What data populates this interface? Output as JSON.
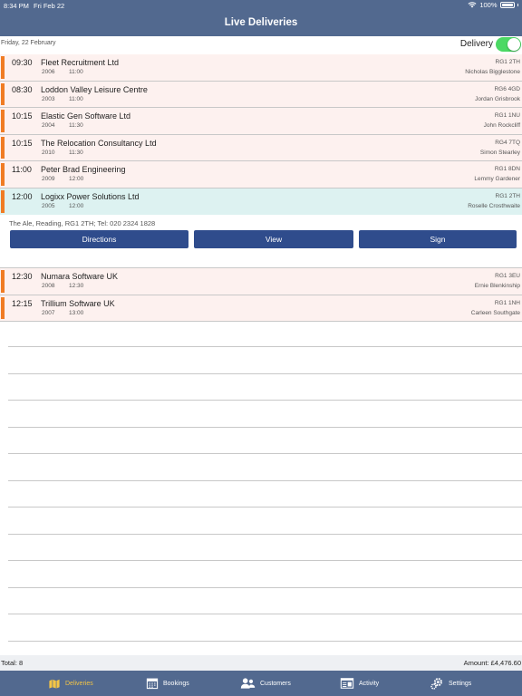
{
  "status": {
    "time": "8:34 PM",
    "date": "Fri Feb 22",
    "battery": "100%"
  },
  "header": {
    "title": "Live Deliveries"
  },
  "datebar": {
    "date": "Friday, 22 February",
    "toggle_label": "Delivery",
    "toggle_on": true
  },
  "deliveries": [
    {
      "time": "09:30",
      "company": "Fleet Recruitment Ltd",
      "code": "2006",
      "slot": "11:00",
      "postcode": "RG1 2TH",
      "contact": "Nicholas Bigglestone"
    },
    {
      "time": "08:30",
      "company": "Loddon Valley Leisure Centre",
      "code": "2003",
      "slot": "11:00",
      "postcode": "RG6 4GD",
      "contact": "Jordan Grisbrook"
    },
    {
      "time": "10:15",
      "company": "Elastic Gen Software Ltd",
      "code": "2004",
      "slot": "11:30",
      "postcode": "RG1 1NU",
      "contact": "John Rockcliff"
    },
    {
      "time": "10:15",
      "company": "The Relocation Consultancy Ltd",
      "code": "2010",
      "slot": "11:30",
      "postcode": "RG4 7TQ",
      "contact": "Simon Stearley"
    },
    {
      "time": "11:00",
      "company": "Peter Brad Engineering",
      "code": "2009",
      "slot": "12:00",
      "postcode": "RG1 8DN",
      "contact": "Lemmy Gardener"
    },
    {
      "time": "12:00",
      "company": "Logixx Power Solutions Ltd",
      "code": "2005",
      "slot": "12:00",
      "postcode": "RG1 2TH",
      "contact": "Roselle Crosthwaite"
    },
    {
      "time": "12:30",
      "company": "Numara Software UK",
      "code": "2008",
      "slot": "12:30",
      "postcode": "RG1 3EU",
      "contact": "Ernie Blenkinship"
    },
    {
      "time": "12:15",
      "company": "Trillium Software UK",
      "code": "2007",
      "slot": "13:00",
      "postcode": "RG1 1NH",
      "contact": "Carleen Southgate"
    }
  ],
  "selected_detail": {
    "address": "The Ale, Reading, RG1 2TH; Tel:  020 2324 1828",
    "buttons": {
      "directions": "Directions",
      "view": "View",
      "sign": "Sign"
    }
  },
  "footer": {
    "total": "Total: 8",
    "amount": "Amount: £4,476.60"
  },
  "tabs": [
    {
      "label": "Deliveries",
      "icon": "map-icon",
      "active": true
    },
    {
      "label": "Bookings",
      "icon": "calendar-icon",
      "active": false
    },
    {
      "label": "Customers",
      "icon": "people-icon",
      "active": false
    },
    {
      "label": "Activity",
      "icon": "activity-icon",
      "active": false
    },
    {
      "label": "Settings",
      "icon": "gear-icon",
      "active": false
    }
  ],
  "colors": {
    "header": "#52698f",
    "accent_bar": "#f07c24",
    "button": "#2f4c8c",
    "active_tab": "#f3c446",
    "toggle": "#4cd964",
    "row_bg": "#fdf1ef",
    "selected_bg": "#ddf2f1"
  }
}
